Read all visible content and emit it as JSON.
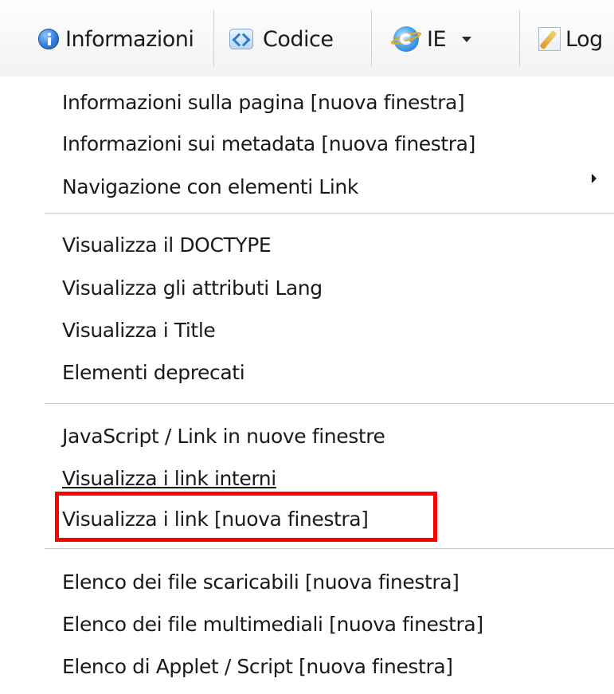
{
  "toolbar": {
    "buttons": [
      {
        "label": "Informazioni",
        "icon": "info-icon"
      },
      {
        "label": "Codice",
        "icon": "code-icon"
      },
      {
        "label": "IE",
        "icon": "ie-icon"
      },
      {
        "label": "Log",
        "icon": "log-icon"
      }
    ]
  },
  "menu": {
    "groups": [
      [
        {
          "label": "Informazioni sulla pagina [nuova finestra]"
        },
        {
          "label": "Informazioni sui metadata [nuova finestra]"
        },
        {
          "label": "Navigazione con elementi Link",
          "has_submenu": true
        }
      ],
      [
        {
          "label": "Visualizza il DOCTYPE"
        },
        {
          "label": "Visualizza gli attributi Lang"
        },
        {
          "label": "Visualizza i Title"
        },
        {
          "label": "Elementi deprecati"
        }
      ],
      [
        {
          "label": "JavaScript /  Link in nuove finestre"
        },
        {
          "label": "Visualizza i link interni"
        },
        {
          "label": "Visualizza i link [nuova finestra]",
          "highlighted": true
        }
      ],
      [
        {
          "label": "Elenco dei file scaricabili [nuova finestra]"
        },
        {
          "label": "Elenco dei file multimediali [nuova finestra]"
        },
        {
          "label": "Elenco di Applet / Script [nuova finestra]"
        }
      ]
    ]
  },
  "colors": {
    "highlight_border": "#ff0000",
    "separator": "#c9c9c9",
    "toolbar_background": "#f3f3f3"
  }
}
